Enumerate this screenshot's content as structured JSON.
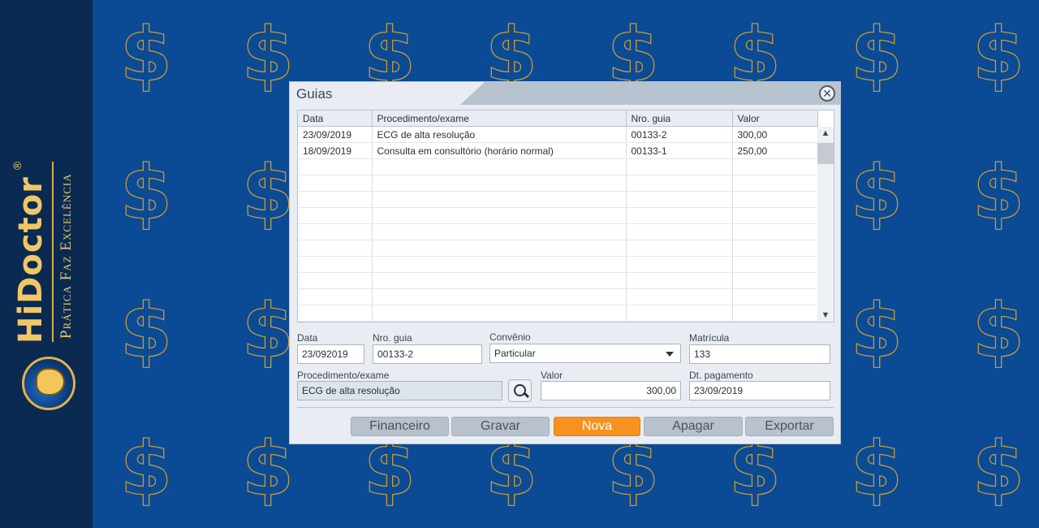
{
  "brand": {
    "name": "HiDoctor",
    "reg": "®",
    "tagline": "Prática Faz Excelência"
  },
  "background": {
    "symbol": "$",
    "color": "#0b4a94",
    "symbol_color": "#c59a3a"
  },
  "dialog": {
    "title": "Guias",
    "close_label": "✕",
    "grid": {
      "columns": [
        "Data",
        "Procedimento/exame",
        "Nro. guia",
        "Valor"
      ],
      "rows": [
        [
          "23/09/2019",
          "ECG de alta resolução",
          "00133-2",
          "300,00"
        ],
        [
          "18/09/2019",
          "Consulta em consultório (horário normal)",
          "00133-1",
          "250,00"
        ]
      ]
    },
    "form": {
      "data": {
        "label": "Data",
        "value": "23/092019"
      },
      "nro_guia": {
        "label": "Nro. guia",
        "value": "00133-2"
      },
      "convenio": {
        "label": "Convênio",
        "value": "Particular"
      },
      "matricula": {
        "label": "Matrícula",
        "value": "133"
      },
      "procedimento": {
        "label": "Procedimento/exame",
        "value": "ECG de alta resolução"
      },
      "valor": {
        "label": "Valor",
        "value": "300,00"
      },
      "dt_pagamento": {
        "label": "Dt. pagamento",
        "value": "23/09/2019"
      }
    },
    "buttons": {
      "financeiro": "Financeiro",
      "gravar": "Gravar",
      "nova": "Nova",
      "apagar": "Apagar",
      "exportar": "Exportar"
    }
  }
}
